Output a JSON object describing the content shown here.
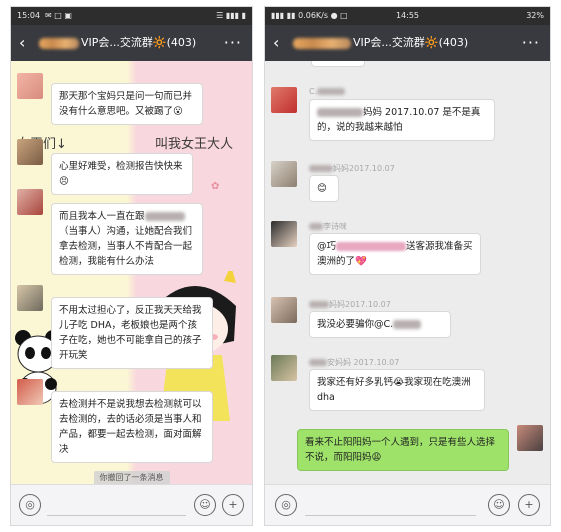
{
  "left": {
    "status": {
      "time": "15:04",
      "icons": "✉ □ ▣",
      "right": "☰ ▮▮▮ ▮"
    },
    "header": {
      "title": "VIP会...交流群🔆(403)",
      "back": "‹",
      "more": "···"
    },
    "bg_texts": [
      "女王们↓",
      "叫我女王大人"
    ],
    "messages": [
      {
        "text": "那天那个宝妈只是问一句而已并没有什么意思吧。又被踢了😮"
      },
      {
        "text": "心里好难受，检测报告快快来😣"
      },
      {
        "pre": "而且我本人一直在跟",
        "post": "（当事人）沟通，让她配合我们拿去检测，当事人不肯配合一起检测，我能有什么办法"
      },
      {
        "text": "不用太过担心了，反正我天天给我儿子吃 DHA，老板娘也是两个孩子在吃，她也不可能拿自己的孩子开玩笑"
      },
      {
        "text": "去检测并不是说我想去检测就可以去检测的，去的话必须是当事人和产品，都要一起去检测，面对面解决"
      }
    ],
    "recall": "你撤回了一条消息",
    "input": {
      "voice": "◎",
      "emoji": "☺",
      "plus": "+"
    }
  },
  "right": {
    "status": {
      "left": "▮▮▮ ▮▮ 0.06K/s ● □",
      "time": "14:55",
      "battery": "32%"
    },
    "header": {
      "title": "VIP会...交流群🔆(403)",
      "back": "‹",
      "more": "···"
    },
    "messages": [
      {
        "sender": "C.",
        "pre": "",
        "post": "妈妈 2017.10.07 是不是真的，说的我越来越怕"
      },
      {
        "sender": "妈妈2017.10.07",
        "text": "😊"
      },
      {
        "sender": "李诗咪",
        "pre": "@巧",
        "post": "送客源我准备买澳洲的了💖"
      },
      {
        "sender": "妈妈2017.10.07",
        "text": "我没必要骗你@C."
      },
      {
        "sender": "安妈妈 2017.10.07",
        "text": "我家还有好多乳钙😭我家现在吃澳洲 dha"
      },
      {
        "text": "看来不止阳阳妈一个人遇到，只是有些人选择不说，而阳阳妈😩"
      }
    ],
    "input": {
      "voice": "◎",
      "emoji": "☺",
      "plus": "+"
    }
  }
}
